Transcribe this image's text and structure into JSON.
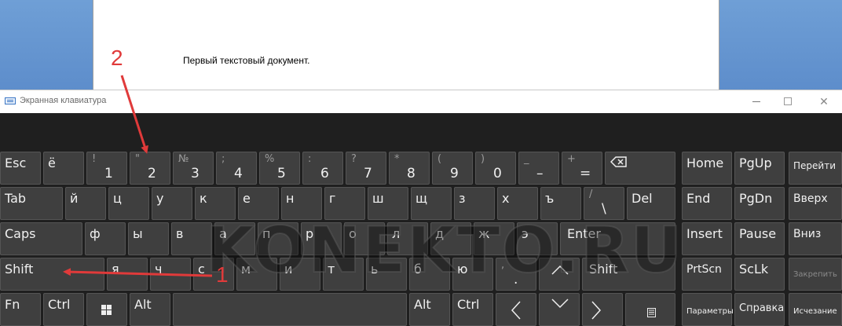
{
  "document": {
    "text": "Первый текстовый документ."
  },
  "window": {
    "title": "Экранная клавиатура",
    "close_glyph": "✕"
  },
  "watermark": "KONEKTO.RU",
  "annotations": {
    "one": "1",
    "two": "2"
  },
  "keys": {
    "esc": "Esc",
    "yo": "ё",
    "d1": "1",
    "d1s": "!",
    "d2": "2",
    "d2s": "\"",
    "d3": "3",
    "d3s": "№",
    "d4": "4",
    "d4s": ";",
    "d5": "5",
    "d5s": "%",
    "d6": "6",
    "d6s": ":",
    "d7": "7",
    "d7s": "?",
    "d8": "8",
    "d8s": "*",
    "d9": "9",
    "d9s": "(",
    "d0": "0",
    "d0s": ")",
    "minus": "–",
    "minus_s": "_",
    "eq": "=",
    "eq_s": "+",
    "tab": "Tab",
    "q": "й",
    "w": "ц",
    "e": "у",
    "r": "к",
    "t": "е",
    "y": "н",
    "u": "г",
    "i": "ш",
    "o": "щ",
    "p": "з",
    "lb": "х",
    "rb": "ъ",
    "bs": "\\",
    "bs_s": "/",
    "del": "Del",
    "caps": "Caps",
    "a": "ф",
    "s": "ы",
    "d": "в",
    "f": "а",
    "g": "п",
    "h": "р",
    "j": "о",
    "k": "л",
    "l": "д",
    "semi": "ж",
    "quote": "э",
    "enter": "Enter",
    "shift_l": "Shift",
    "z": "я",
    "x": "ч",
    "c": "с",
    "v": "м",
    "b": "и",
    "n": "т",
    "m": "ь",
    "comma": "б",
    "period": "ю",
    "slash": ".",
    "slash_s": ",",
    "shift_r": "Shift",
    "fn": "Fn",
    "ctrl_l": "Ctrl",
    "alt_l": "Alt",
    "alt_r": "Alt",
    "ctrl_r": "Ctrl",
    "home": "Home",
    "pgup": "PgUp",
    "goto": "Перейти",
    "end": "End",
    "pgdn": "PgDn",
    "up": "Вверх",
    "insert": "Insert",
    "pause": "Pause",
    "down": "Вниз",
    "prtscn": "PrtScn",
    "sclk": "ScLk",
    "lock": "Закрепить",
    "params": "Параметры",
    "help": "Справка",
    "fade": "Исчезание"
  }
}
